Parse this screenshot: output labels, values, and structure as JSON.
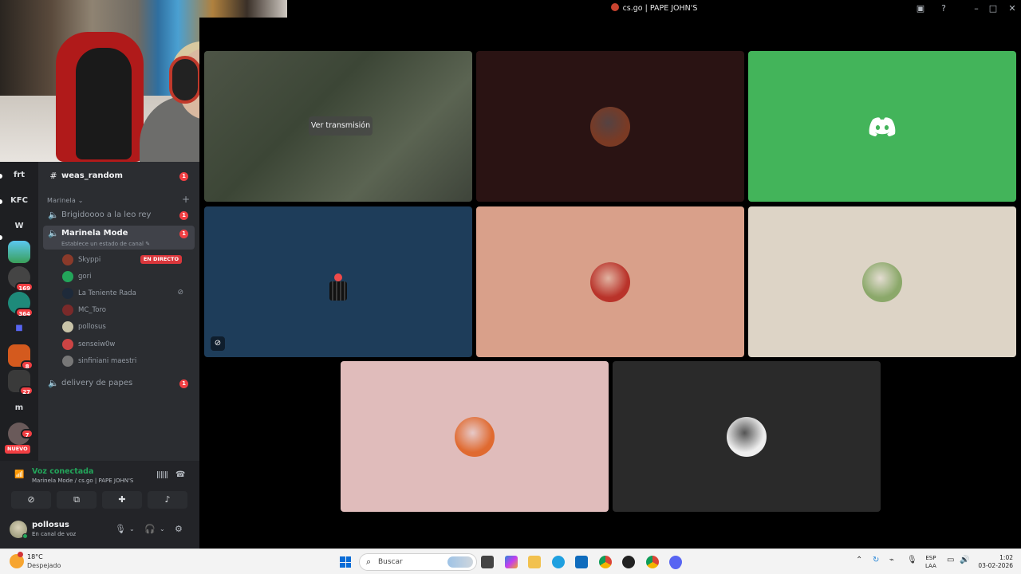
{
  "window": {
    "title": "cs.go | PAPE JOHN'S"
  },
  "servers": [
    {
      "label": "frt"
    },
    {
      "label": "KFC"
    },
    {
      "label": "W"
    },
    {
      "label": "",
      "badge": ""
    },
    {
      "label": "",
      "badge": "169"
    },
    {
      "label": "",
      "badge": "364"
    },
    {
      "label": ""
    },
    {
      "label": "",
      "badge": "8"
    },
    {
      "label": "",
      "badge": "27"
    },
    {
      "label": "m"
    },
    {
      "label": "",
      "badge": "7",
      "tag": "NUEVO"
    }
  ],
  "channels": {
    "text_channel": {
      "name": "weas_random",
      "badge": "1"
    },
    "category": {
      "name": "Marinela"
    },
    "voice_channels": [
      {
        "name": "Brigidoooo a la leo rey",
        "badge": "1"
      },
      {
        "name": "Marinela Mode",
        "badge": "1",
        "status_placeholder": "Establece un estado de canal"
      },
      {
        "name": "delivery de papes",
        "badge": "1"
      }
    ],
    "voice_users": [
      {
        "name": "Skyppi",
        "live": "EN DIRECTO",
        "color": "#8a3a2a"
      },
      {
        "name": "gori",
        "color": "#23a55a"
      },
      {
        "name": "La Teniente Rada",
        "color": "#1e2a3a",
        "muted": true
      },
      {
        "name": "MC_Toro",
        "color": "#7a2a2a"
      },
      {
        "name": "pollosus",
        "color": "#c8c3a8"
      },
      {
        "name": "senseiw0w",
        "color": "#c44"
      },
      {
        "name": "sinfiniani maestri",
        "color": "#777"
      }
    ]
  },
  "voice_panel": {
    "title": "Voz conectada",
    "subtitle": "Marinela Mode / cs.go | PAPE JOHN'S"
  },
  "user_panel": {
    "name": "pollosus",
    "status": "En canal de voz"
  },
  "call": {
    "stream_button": "Ver transmisión",
    "tiles": [
      {
        "bg": "#2a1313",
        "avatar": "#7a3a24"
      },
      {
        "bg": "#43b45a",
        "avatar": ""
      },
      {
        "bg": "#1e3d5a",
        "avatar": ""
      },
      {
        "bg": "#d9a08a",
        "avatar": "#b9332a"
      },
      {
        "bg": "#ddd4c6",
        "avatar": "#8ba86a"
      },
      {
        "bg": "#e0bcbb",
        "avatar": "#e06a30"
      },
      {
        "bg": "#2a2a2a",
        "avatar": "#eeeeee"
      }
    ]
  },
  "taskbar": {
    "weather_temp": "18°C",
    "weather_desc": "Despejado",
    "search_placeholder": "Buscar",
    "lang_line1": "ESP",
    "lang_line2": "LAA",
    "time": "1:02",
    "date": "03-02-2026"
  }
}
